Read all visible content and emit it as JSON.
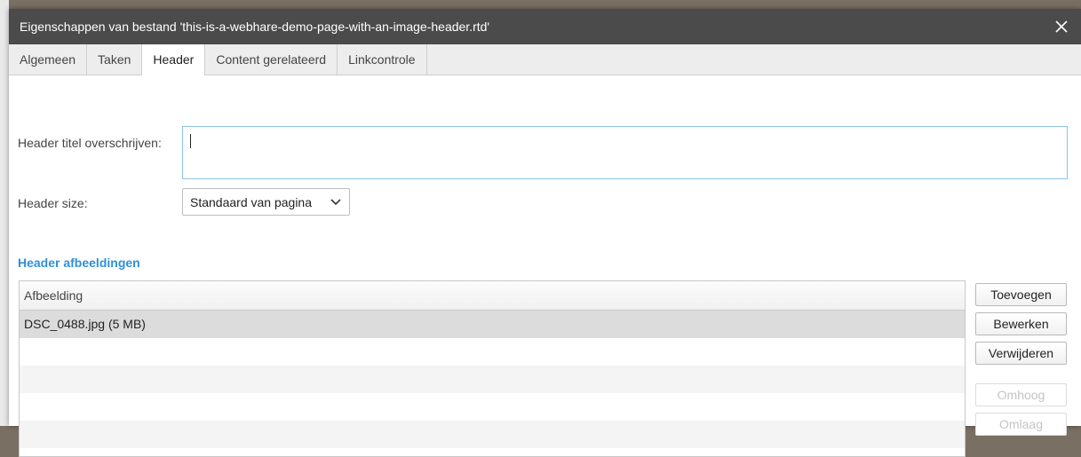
{
  "dialog": {
    "title": "Eigenschappen van bestand 'this-is-a-webhare-demo-page-with-an-image-header.rtd'",
    "close_icon": "✕"
  },
  "tabs": [
    {
      "label": "Algemeen",
      "active": false
    },
    {
      "label": "Taken",
      "active": false
    },
    {
      "label": "Header",
      "active": true
    },
    {
      "label": "Content gerelateerd",
      "active": false
    },
    {
      "label": "Linkcontrole",
      "active": false
    }
  ],
  "form": {
    "title_label": "Header titel overschrijven:",
    "title_value": "",
    "size_label": "Header size:",
    "size_value": "Standaard van pagina"
  },
  "images": {
    "heading": "Header afbeeldingen",
    "column_header": "Afbeelding",
    "rows": [
      "DSC_0488.jpg (5 MB)"
    ]
  },
  "buttons": {
    "add": "Toevoegen",
    "edit": "Bewerken",
    "delete": "Verwijderen",
    "up": "Omhoog",
    "down": "Omlaag"
  },
  "colors": {
    "titlebar": "#4b4b4b",
    "accent": "#2f8fd8",
    "focus_border": "#8ec3e8"
  }
}
